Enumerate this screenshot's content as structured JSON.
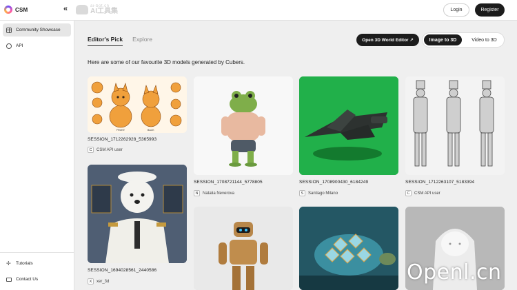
{
  "brand": {
    "name": "CSM"
  },
  "watermark": {
    "top": "ai-bot.cn",
    "bottom": "AI工具集"
  },
  "header": {
    "collapse_icon": "«",
    "login": "Login",
    "register": "Register"
  },
  "sidebar": {
    "items": [
      {
        "label": "Community Showcase",
        "icon": "grid-icon",
        "active": true
      },
      {
        "label": "API",
        "icon": "api-icon",
        "active": false
      }
    ],
    "bottom_items": [
      {
        "label": "Tutorials",
        "icon": "tutorials-icon"
      },
      {
        "label": "Contact Us",
        "icon": "mail-icon"
      }
    ]
  },
  "main": {
    "tabs": [
      {
        "label": "Editor's Pick",
        "active": true
      },
      {
        "label": "Explore",
        "active": false
      }
    ],
    "world_editor_button": "Open 3D World Editor ↗",
    "mode_toggle": {
      "options": [
        "Image to 3D",
        "Video to 3D"
      ],
      "selected": "Image to 3D"
    },
    "intro_text": "Here are some of our favourite 3D models generated by Cubers.",
    "cards": [
      {
        "title": "SESSION_1712262928_5365993",
        "avatar": "C",
        "user": "CSM API user"
      },
      {
        "title": "SESSION_1708721144_5778805",
        "avatar": "N",
        "user": "Natalia Neverova"
      },
      {
        "title": "SESSION_1708900430_6184249",
        "avatar": "S",
        "user": "Santiago Milano"
      },
      {
        "title": "SESSION_1712263107_5183394",
        "avatar": "C",
        "user": "CSM API user"
      },
      {
        "title": "SESSION_1694028561_2440586",
        "avatar": "X",
        "user": "xer_3d"
      }
    ],
    "sheet_labels": {
      "front": "FRONT",
      "back": "BACK"
    }
  },
  "overlay_watermark": "Openl.cn"
}
